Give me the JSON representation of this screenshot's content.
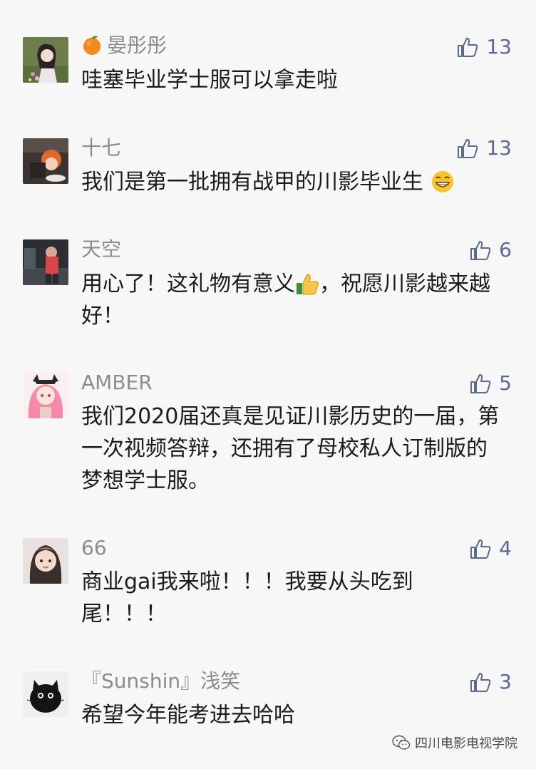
{
  "comments": [
    {
      "name": "晏彤彤",
      "name_emoji": "orange",
      "text": "哇塞毕业学士服可以拿走啦",
      "likes": "13"
    },
    {
      "name": "十七",
      "text": "我们是第一批拥有战甲的川影毕业生",
      "trailing_emoji": "grin",
      "likes": "13"
    },
    {
      "name": "天空",
      "text_part1": "用心了！这礼物有意义",
      "text_part2": "，祝愿川影越来越好！",
      "inline_emoji": "thumbs-up",
      "likes": "6"
    },
    {
      "name": "AMBER",
      "text": "我们2020届还真是见证川影历史的一届，第一次视频答辩，还拥有了母校私人订制版的梦想学士服。",
      "likes": "5"
    },
    {
      "name": "66",
      "text": "商业gai我来啦！！！我要从头吃到尾！！！",
      "likes": "4"
    },
    {
      "name": "『Sunshin』浅笑",
      "text": "希望今年能考进去哈哈",
      "likes": "3"
    }
  ],
  "footer": {
    "account": "四川电影电视学院"
  },
  "colors": {
    "like": "#5a6a92",
    "name": "#8c8c8c",
    "text": "#1b1b1b"
  }
}
